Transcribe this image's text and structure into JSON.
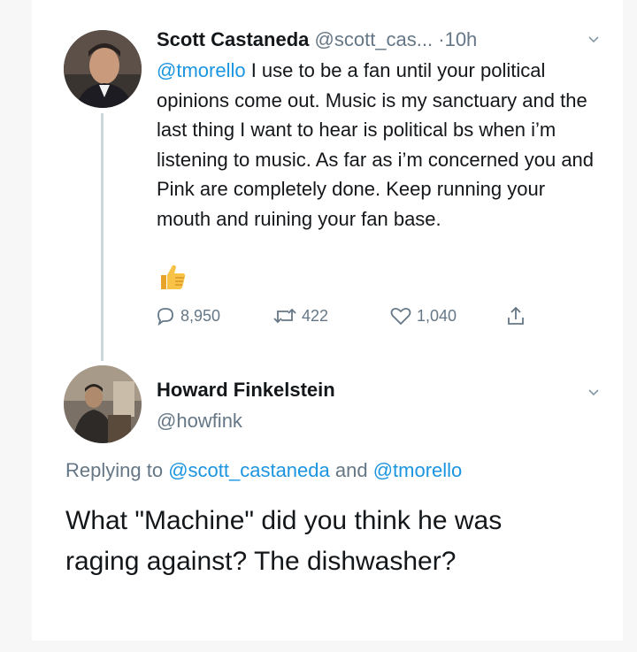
{
  "tweet1": {
    "display_name": "Scott Castaneda",
    "handle": "@scott_cas...",
    "separator": "·",
    "time": "10h",
    "mention": "@tmorello",
    "text": " I use to be a fan until your political opinions come out. Music is my sanctuary and the last thing I want to hear is political bs when i’m listening to music. As far as i’m concerned you and Pink are completely done. Keep running your mouth and ruining your fan base.",
    "emoji": "thumbs-up-icon",
    "replies": "8,950",
    "retweets": "422",
    "likes": "1,040"
  },
  "tweet2": {
    "display_name": "Howard Finkelstein",
    "handle": "@howfink",
    "replying_prefix": "Replying to ",
    "replying_user1": "@scott_castaneda",
    "replying_and": " and ",
    "replying_user2": "@tmorello",
    "text": "What \"Machine\" did you think he was raging against? The dishwasher?"
  },
  "colors": {
    "link": "#1b95e0",
    "secondary_text": "#657786",
    "primary_text": "#14171a"
  }
}
